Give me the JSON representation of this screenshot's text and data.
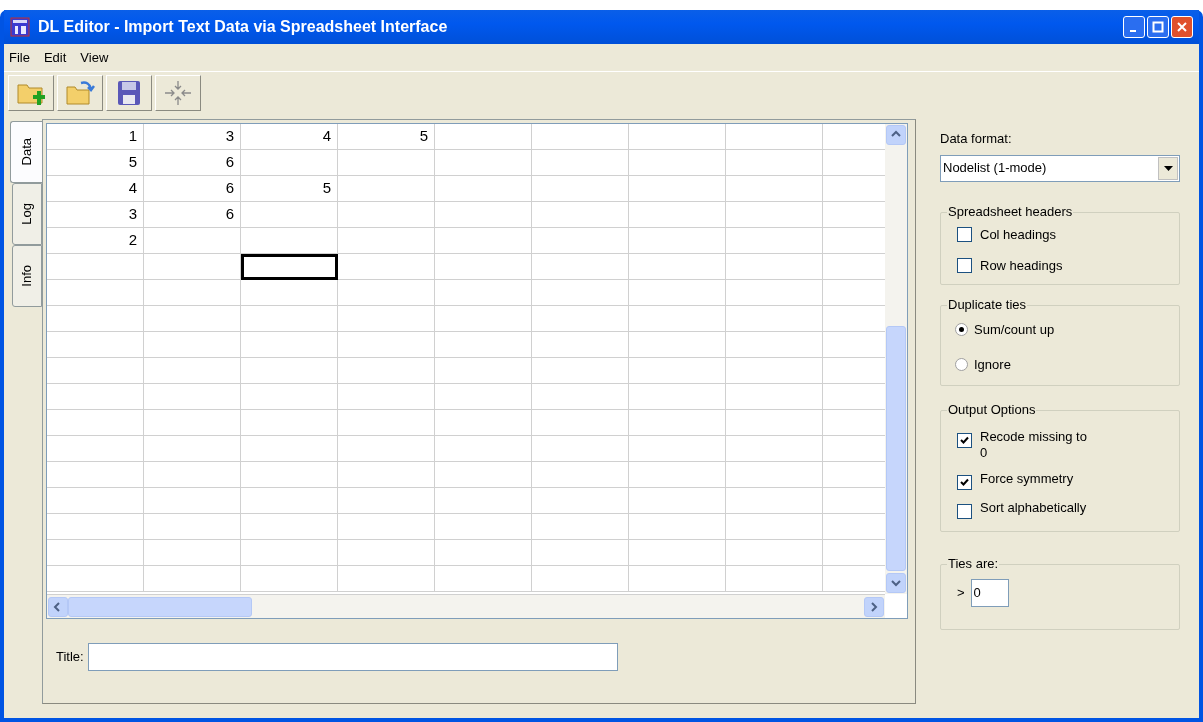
{
  "window": {
    "title": "DL Editor - Import Text Data via Spreadsheet Interface"
  },
  "menu": [
    "File",
    "Edit",
    "View"
  ],
  "side_tabs": [
    {
      "label": "Data",
      "selected": true
    },
    {
      "label": "Log",
      "selected": false
    },
    {
      "label": "Info",
      "selected": false
    }
  ],
  "grid": {
    "rows": [
      {
        "cells": [
          {
            "value": "1",
            "selected": false
          },
          {
            "value": "3",
            "selected": false
          },
          {
            "value": "4",
            "selected": false
          },
          {
            "value": "5",
            "selected": false
          }
        ]
      },
      {
        "cells": [
          {
            "value": "5",
            "selected": false
          },
          {
            "value": "6",
            "selected": false
          }
        ]
      },
      {
        "cells": [
          {
            "value": "4",
            "selected": false
          },
          {
            "value": "6",
            "selected": false
          },
          {
            "value": "5",
            "selected": false
          }
        ]
      },
      {
        "cells": [
          {
            "value": "3",
            "selected": false
          },
          {
            "value": "6",
            "selected": false
          }
        ]
      },
      {
        "cells": [
          {
            "value": "2",
            "selected": false
          }
        ]
      },
      {
        "cells": [
          {
            "selected": false
          },
          {
            "selected": false
          },
          {
            "selected": true
          }
        ]
      }
    ]
  },
  "title_field": {
    "label": "Title:"
  },
  "data_format": {
    "label": "Data format:",
    "value": "Nodelist (1-mode)"
  },
  "spreadsheet_headers": {
    "title": "Spreadsheet headers",
    "options": [
      {
        "label": "Col headings",
        "checked": false
      },
      {
        "label": "Row headings",
        "checked": false
      }
    ]
  },
  "duplicate_ties": {
    "title": "Duplicate ties",
    "options": [
      {
        "label": "Sum/count up",
        "selected": true
      },
      {
        "label": "Ignore",
        "selected": false
      }
    ]
  },
  "output_options": {
    "title": "Output Options",
    "options": [
      {
        "label": "Recode missing to 0",
        "checked": true
      },
      {
        "label": "Force symmetry",
        "checked": true
      },
      {
        "label": "Sort alphabetically",
        "checked": false
      }
    ]
  },
  "ties_are": {
    "title": "Ties are:",
    "operator": ">",
    "value": "0"
  }
}
